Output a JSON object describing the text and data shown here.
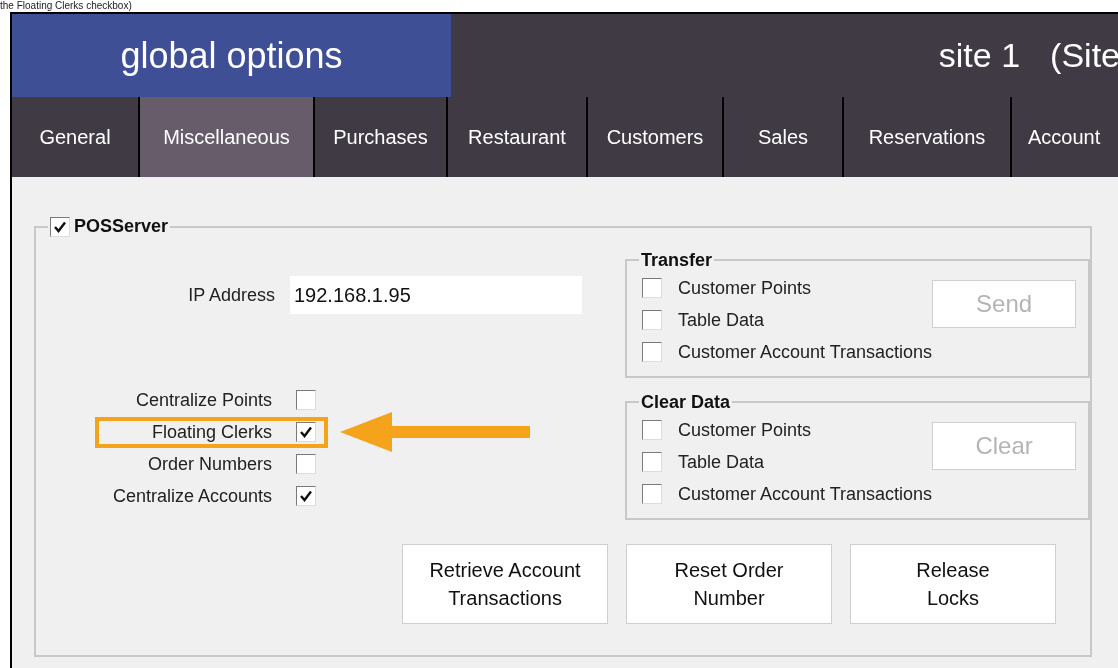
{
  "caption": "the Floating Clerks checkbox)",
  "header": {
    "title": "global options",
    "site": "site 1",
    "site_suffix": "(Site"
  },
  "tabs": [
    {
      "label": "General",
      "selected": false
    },
    {
      "label": "Miscellaneous",
      "selected": true
    },
    {
      "label": "Purchases",
      "selected": false
    },
    {
      "label": "Restaurant",
      "selected": false
    },
    {
      "label": "Customers",
      "selected": false
    },
    {
      "label": "Sales",
      "selected": false
    },
    {
      "label": "Reservations",
      "selected": false
    },
    {
      "label": "Account",
      "selected": false
    }
  ],
  "pos_server": {
    "label": "POSServer",
    "checked": true,
    "ip_label": "IP Address",
    "ip_value": "192.168.1.95",
    "options": [
      {
        "label": "Centralize Points",
        "checked": false,
        "highlighted": false
      },
      {
        "label": "Floating Clerks",
        "checked": true,
        "highlighted": true
      },
      {
        "label": "Order Numbers",
        "checked": false,
        "highlighted": false
      },
      {
        "label": "Centralize Accounts",
        "checked": true,
        "highlighted": false
      }
    ],
    "groups": [
      {
        "title": "Transfer",
        "button": "Send",
        "button_disabled": true,
        "items": [
          {
            "label": "Customer Points",
            "checked": false
          },
          {
            "label": "Table Data",
            "checked": false
          },
          {
            "label": "Customer Account Transactions",
            "checked": false
          }
        ]
      },
      {
        "title": "Clear Data",
        "button": "Clear",
        "button_disabled": true,
        "items": [
          {
            "label": "Customer Points",
            "checked": false
          },
          {
            "label": "Table Data",
            "checked": false
          },
          {
            "label": "Customer Account Transactions",
            "checked": false
          }
        ]
      }
    ],
    "buttons": [
      [
        "Retrieve Account",
        "Transactions"
      ],
      [
        "Reset Order",
        "Number"
      ],
      [
        "Release",
        "Locks"
      ]
    ]
  }
}
